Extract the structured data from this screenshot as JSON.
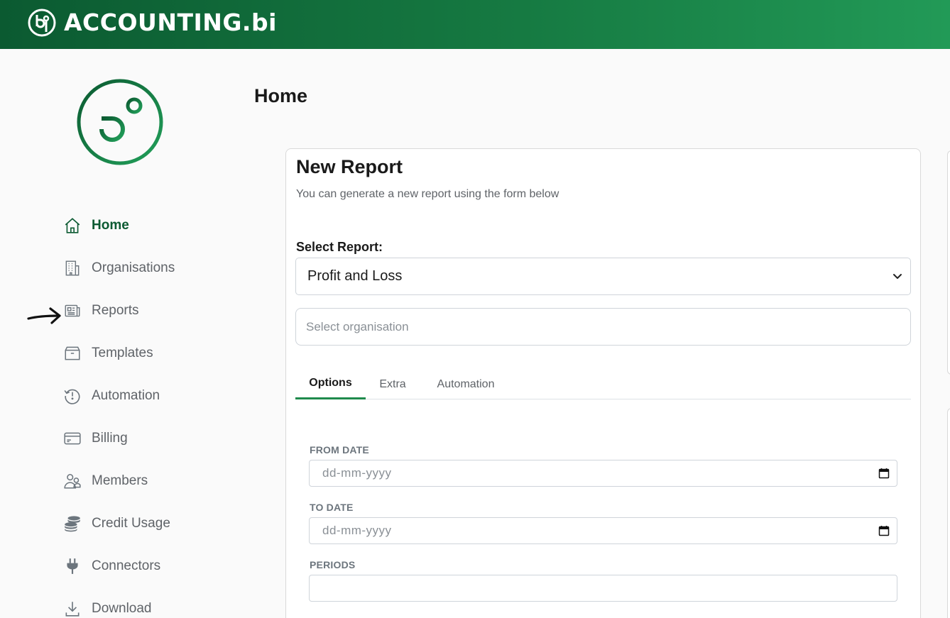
{
  "header": {
    "brand_text": "ACCOUNTING.bi"
  },
  "sidebar": {
    "items": [
      {
        "label": "Home",
        "icon": "home-icon",
        "active": true
      },
      {
        "label": "Organisations",
        "icon": "building-icon"
      },
      {
        "label": "Reports",
        "icon": "newspaper-icon"
      },
      {
        "label": "Templates",
        "icon": "archive-box-icon"
      },
      {
        "label": "Automation",
        "icon": "history-icon"
      },
      {
        "label": "Billing",
        "icon": "credit-card-icon"
      },
      {
        "label": "Members",
        "icon": "people-icon"
      },
      {
        "label": "Credit Usage",
        "icon": "coins-icon"
      },
      {
        "label": "Connectors",
        "icon": "plug-icon"
      },
      {
        "label": "Download",
        "icon": "download-icon"
      }
    ]
  },
  "main": {
    "page_title": "Home",
    "card": {
      "title": "New Report",
      "subtitle": "You can generate a new report using the form below",
      "select_report_label": "Select Report:",
      "select_report_value": "Profit and Loss",
      "organisation_placeholder": "Select organisation",
      "tabs": [
        {
          "label": "Options",
          "active": true
        },
        {
          "label": "Extra"
        },
        {
          "label": "Automation"
        }
      ],
      "fields": {
        "from_date_label": "FROM DATE",
        "from_date_placeholder": "dd-mm-yyyy",
        "to_date_label": "TO DATE",
        "to_date_placeholder": "dd-mm-yyyy",
        "periods_label": "PERIODS",
        "periods_value": ""
      }
    }
  },
  "colors": {
    "header_start": "#0b5a31",
    "header_end": "#229a57",
    "accent": "#1f8a4c",
    "active_nav": "#0c5a32"
  }
}
